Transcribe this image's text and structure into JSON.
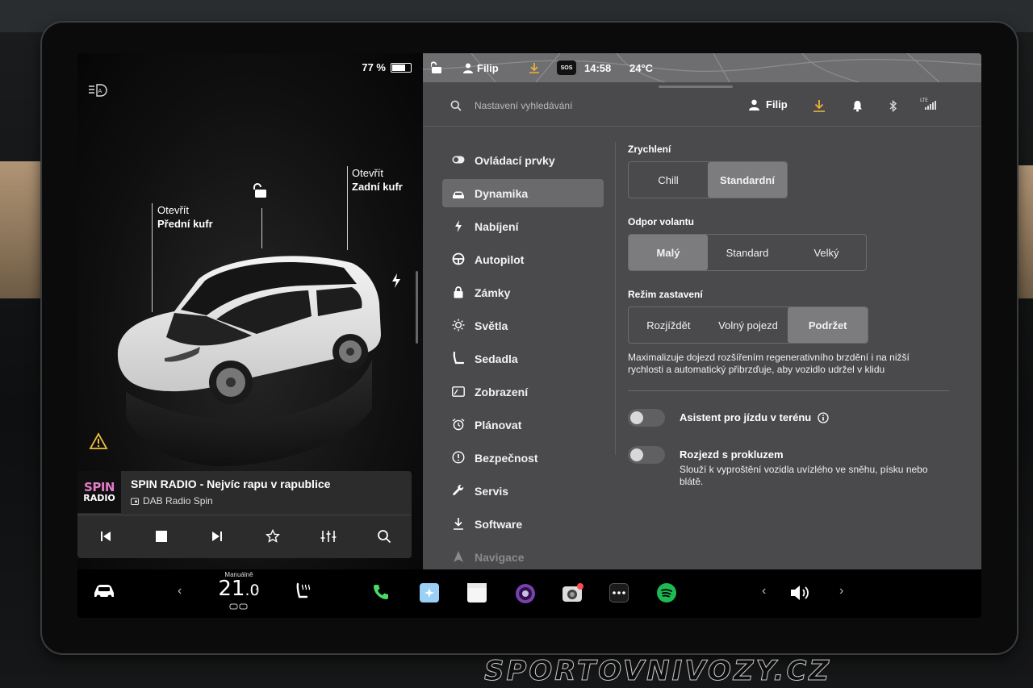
{
  "left_panel": {
    "battery_percent": "77 %",
    "battery_level": 0.77,
    "frunk": {
      "line1": "Otevřít",
      "line2": "Přední kufr"
    },
    "trunk": {
      "line1": "Otevřít",
      "line2": "Zadní kufr"
    }
  },
  "media": {
    "art_line1": "SPIN",
    "art_line2": "RADIO",
    "station": "SPIN RADIO - Nejvíc rapu v rapublice",
    "source": "DAB Radio Spin"
  },
  "status_bar": {
    "user": "Filip",
    "time": "14:58",
    "temperature": "24°C",
    "sos": "SOS"
  },
  "header": {
    "search_placeholder": "Nastavení vyhledávání",
    "user": "Filip",
    "lte": "LTE"
  },
  "nav": {
    "items": [
      {
        "label": "Ovládací prvky",
        "icon": "toggle-icon"
      },
      {
        "label": "Dynamika",
        "icon": "car-icon",
        "active": true
      },
      {
        "label": "Nabíjení",
        "icon": "bolt-icon"
      },
      {
        "label": "Autopilot",
        "icon": "steering-wheel-icon"
      },
      {
        "label": "Zámky",
        "icon": "lock-icon"
      },
      {
        "label": "Světla",
        "icon": "sun-icon"
      },
      {
        "label": "Sedadla",
        "icon": "seat-icon"
      },
      {
        "label": "Zobrazení",
        "icon": "display-icon"
      },
      {
        "label": "Plánovat",
        "icon": "alarm-clock-icon"
      },
      {
        "label": "Bezpečnost",
        "icon": "info-circle-icon"
      },
      {
        "label": "Servis",
        "icon": "wrench-icon"
      },
      {
        "label": "Software",
        "icon": "download-icon"
      },
      {
        "label": "Navigace",
        "icon": "navigation-arrow-icon"
      }
    ]
  },
  "dynamics": {
    "acceleration": {
      "title": "Zrychlení",
      "options": [
        "Chill",
        "Standardní"
      ],
      "selected": "Standardní"
    },
    "steering": {
      "title": "Odpor volantu",
      "options": [
        "Malý",
        "Standard",
        "Velký"
      ],
      "selected": "Malý"
    },
    "stopping": {
      "title": "Režim zastavení",
      "options": [
        "Rozjíždět",
        "Volný pojezd",
        "Podržet"
      ],
      "selected": "Podržet"
    },
    "stopping_desc": "Maximalizuje dojezd rozšířením regenerativního brzdění i na nižší rychlosti a automatický přibrzďuje, aby vozidlo udržel v klidu",
    "offroad": {
      "label": "Asistent pro jízdu v terénu",
      "enabled": false
    },
    "slip": {
      "label": "Rozjezd s prokluzem",
      "desc": "Slouží k vyproštění vozidla uvízlého ve sněhu, písku nebo blátě.",
      "enabled": false
    }
  },
  "bottom_bar": {
    "climate_mode": "Manuálně",
    "temp_int": "21",
    "temp_dec": ".0"
  },
  "watermark": "SPORTOVNIVOZY.CZ",
  "colors": {
    "panel_bg": "#4a4a4c",
    "selected_segment": "#7c7b7d",
    "accent_download": "#e8b23a",
    "phone_green": "#4cd964",
    "spotify_green": "#1db954",
    "art_pink": "#e27ac6"
  }
}
